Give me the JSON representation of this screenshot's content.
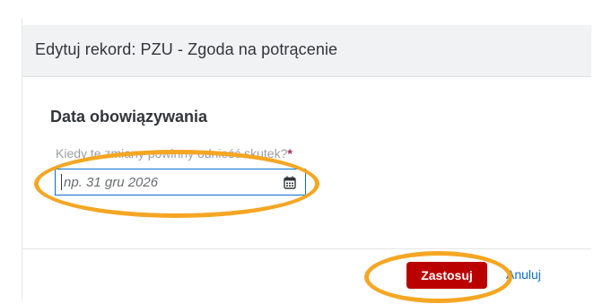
{
  "dialog": {
    "title": "Edytuj rekord: PZU - Zgoda na potrącenie"
  },
  "section": {
    "title": "Data obowiązywania"
  },
  "effective_date_field": {
    "label": "Kiedy te zmiany powinny odnieść skutek?",
    "required_mark": "*",
    "placeholder": "np. 31 gru 2026",
    "icon": "calendar-icon"
  },
  "footer": {
    "apply_label": "Zastosuj",
    "cancel_label": "Anuluj"
  },
  "colors": {
    "primary_button": "#bb0000",
    "link": "#0a6ed1",
    "focus_border": "#0a6ed1",
    "required": "#a4245c",
    "annotation": "#f5a623"
  }
}
